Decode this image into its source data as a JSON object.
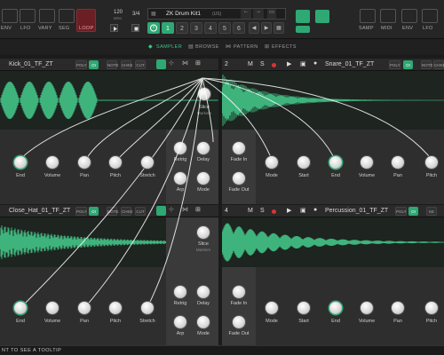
{
  "toolbar": {
    "left_modules": [
      "ENV",
      "LFO",
      "VARY",
      "SEG",
      "LOOP"
    ],
    "tempo": "120",
    "tempo_unit": "BPM",
    "time_sig": "3/4",
    "preset_name": "ZK Drum Kit1",
    "preset_suffix": "(US)",
    "pads": [
      "1",
      "2",
      "3",
      "4",
      "5",
      "6"
    ],
    "right_modules": [
      "SAMP",
      "MIDI",
      "ENV",
      "LFO",
      "VARY"
    ]
  },
  "tabs": [
    "SAMPLER",
    "BROWSE",
    "PATTERN",
    "EFFECTS"
  ],
  "tracks": [
    {
      "name": "Kick_01_TF_ZT",
      "number": "1",
      "poly": "POLY",
      "pills": [
        "OI",
        "KE",
        "P",
        "OFF"
      ],
      "pill_sub": [
        "NOTE",
        "CHKE",
        "CUT"
      ],
      "knobs": [
        "End",
        "Volume",
        "Pan",
        "Pitch",
        "Stretch"
      ],
      "mid_top": "Slice",
      "mid_top_sub": "Markers",
      "mid_knobs": [
        "Retrig",
        "Delay",
        "Arp",
        "Mode"
      ]
    },
    {
      "name": "Snare_01_TF_ZT",
      "number": "2",
      "poly": "POLY",
      "pills": [
        "OI",
        "KE",
        "P",
        "OFF"
      ],
      "pill_sub": [
        "NOTE",
        "CHKE",
        "CUT"
      ],
      "side": [
        "Fade In",
        "Fade Out"
      ],
      "knobs": [
        "Mode",
        "Start",
        "End",
        "Volume",
        "Pan",
        "Pitch"
      ],
      "m": "M",
      "s": "S"
    },
    {
      "name": "Close_Hat_01_TF_ZT",
      "number": "3",
      "poly": "POLY",
      "pills": [
        "OI",
        "KE",
        "P",
        "OFF"
      ],
      "pill_sub": [
        "NOTE",
        "CHKE",
        "CUT"
      ],
      "knobs": [
        "End",
        "Volume",
        "Pan",
        "Pitch",
        "Stretch"
      ],
      "mid_top": "Slice",
      "mid_top_sub": "Markers",
      "mid_knobs": [
        "Retrig",
        "Delay",
        "Arp",
        "Mode"
      ]
    },
    {
      "name": "Percussion_01_TF_ZT",
      "number": "4",
      "poly": "POLY",
      "pills": [
        "OI",
        "KE"
      ],
      "side": [
        "Fade In",
        "Fade Out"
      ],
      "knobs": [
        "Mode",
        "Start",
        "End",
        "Volume",
        "Pan",
        "Pitch"
      ],
      "m": "M",
      "s": "S"
    }
  ],
  "status": "NT TO SEE A TOOLTIP",
  "colors": {
    "accent": "#2fa874",
    "background": "#1b1b1b",
    "panel": "#2e2e2e",
    "loop": "#6b1f24"
  }
}
